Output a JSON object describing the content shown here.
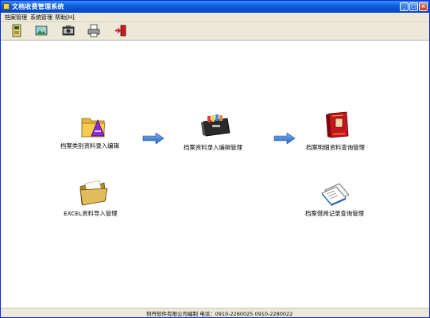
{
  "window": {
    "title": "文档收费管理系统"
  },
  "window_buttons": {
    "minimize": "_",
    "maximize": "□",
    "close": "×"
  },
  "menu": {
    "items": [
      "档案管理",
      "系统管理",
      "帮助[H]"
    ]
  },
  "toolbar": {
    "icons": [
      "notebook-icon",
      "image-icon",
      "camera-icon",
      "printer-icon",
      "exit-icon"
    ]
  },
  "features": [
    {
      "label": "档案类别资料录入编辑",
      "icon": "folder-tools-icon"
    },
    {
      "label": "档案资料录入编辑管理",
      "icon": "file-cabinet-icon"
    },
    {
      "label": "档案明细资料查询管理",
      "icon": "red-book-icon"
    },
    {
      "label": "EXCEL资料导入管理",
      "icon": "open-folder-icon"
    },
    {
      "label": "档案借阅记录查询管理",
      "icon": "documents-icon"
    }
  ],
  "status": {
    "text": "何丹软件有限公司编制   电话：0910-2280025 0910-2280022"
  },
  "colors": {
    "titlebar": "#0a5ddb",
    "arrow": "#3b7fd6",
    "menubar": "#ece9d8"
  }
}
